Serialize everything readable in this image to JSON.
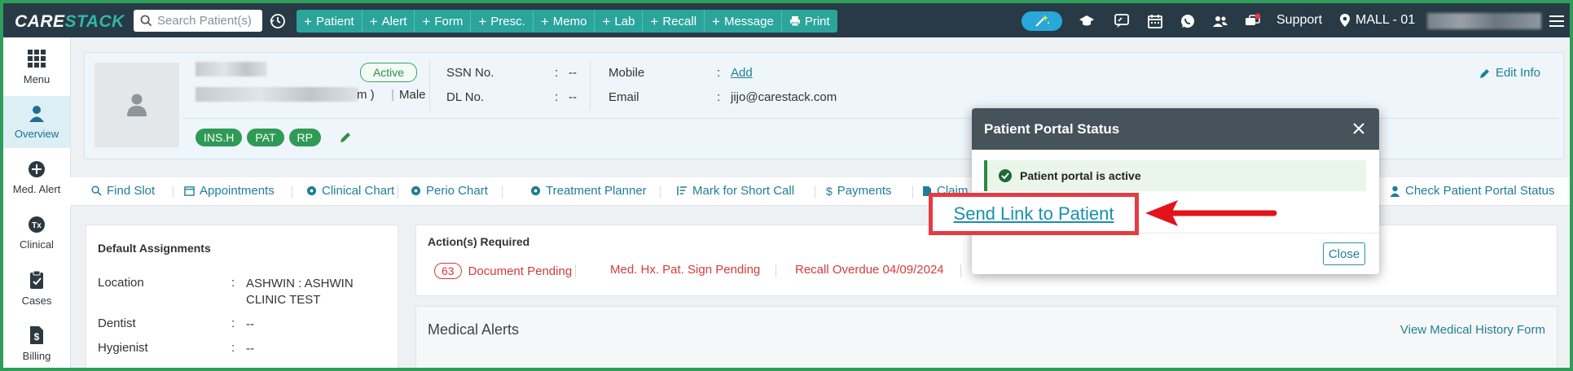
{
  "topbar": {
    "logo_a": "CARE",
    "logo_b": "STACK",
    "search_placeholder": "Search Patient(s)",
    "actions": [
      {
        "label": "Patient",
        "icon": "plus-icon"
      },
      {
        "label": "Alert",
        "icon": "plus-icon"
      },
      {
        "label": "Form",
        "icon": "plus-icon"
      },
      {
        "label": "Presc.",
        "icon": "plus-icon"
      },
      {
        "label": "Memo",
        "icon": "plus-icon"
      },
      {
        "label": "Lab",
        "icon": "plus-icon"
      },
      {
        "label": "Recall",
        "icon": "plus-icon"
      },
      {
        "label": "Message",
        "icon": "plus-icon"
      },
      {
        "label": "Print",
        "icon": "printer-icon"
      }
    ],
    "support_label": "Support",
    "location_label": "MALL - 01"
  },
  "sidebar": {
    "items": [
      {
        "label": "Menu",
        "icon": "grid-icon"
      },
      {
        "label": "Overview",
        "icon": "person-icon",
        "active": true
      },
      {
        "label": "Med. Alert",
        "icon": "plus-circle-icon"
      },
      {
        "label": "Clinical",
        "icon": "tx-icon"
      },
      {
        "label": "Cases",
        "icon": "clipboard-icon"
      },
      {
        "label": "Billing",
        "icon": "dollar-file-icon"
      }
    ]
  },
  "patient": {
    "status": "Active",
    "name_suffix": "m )",
    "gender": "Male",
    "tags": [
      "INS.H",
      "PAT",
      "RP"
    ],
    "ssn_label": "SSN No.",
    "ssn_value": "--",
    "dl_label": "DL No.",
    "dl_value": "--",
    "mobile_label": "Mobile",
    "mobile_value": "Add",
    "email_label": "Email",
    "email_value": "jijo@carestack.com",
    "edit_label": "Edit Info"
  },
  "nav_links": [
    {
      "label": "Find Slot",
      "icon": "search-icon"
    },
    {
      "label": "Appointments",
      "icon": "calendar-icon"
    },
    {
      "label": "Clinical Chart",
      "icon": "chart-circle-icon"
    },
    {
      "label": "Perio Chart",
      "icon": "chart-circle-icon"
    },
    {
      "label": "Treatment Planner",
      "icon": "chart-circle-icon"
    },
    {
      "label": "Mark for Short Call",
      "icon": "sort-list-icon"
    },
    {
      "label": "Payments",
      "icon": "dollar-icon"
    },
    {
      "label": "Claim",
      "icon": "file-icon"
    },
    {
      "label": "Check Patient Portal Status",
      "icon": "person-icon"
    }
  ],
  "assignments": {
    "title": "Default Assignments",
    "rows": [
      {
        "label": "Location",
        "value": "ASHWIN : ASHWIN CLINIC TEST"
      },
      {
        "label": "Dentist",
        "value": "--"
      },
      {
        "label": "Hygienist",
        "value": "--"
      }
    ]
  },
  "actions_required": {
    "title": "Action(s) Required",
    "document_count": "63",
    "document_label": "Document Pending",
    "medhx_label": "Med. Hx. Pat. Sign Pending",
    "recall_label": "Recall Overdue 04/09/2024"
  },
  "medical_alerts": {
    "title": "Medical Alerts",
    "link": "View Medical History Form"
  },
  "modal": {
    "title": "Patient Portal Status",
    "status_message": "Patient portal is active",
    "send_link_label": "Send Link to Patient",
    "close_label": "Close"
  },
  "colors": {
    "topbar": "#283a45",
    "teal": "#2ba59b",
    "link": "#1e7f96",
    "alert_red": "#d63b3b",
    "highlight_red": "#e53b43",
    "success_green": "#2c8a45"
  }
}
